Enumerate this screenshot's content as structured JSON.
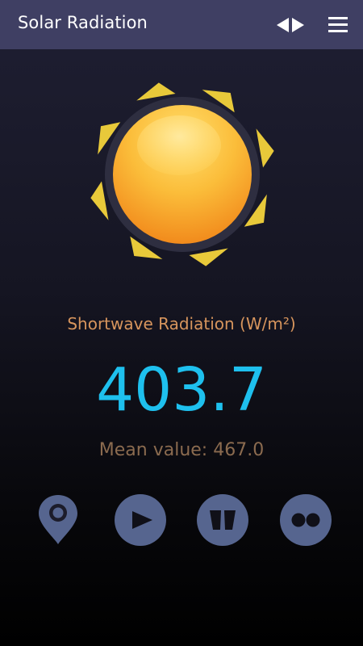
{
  "appbar": {
    "title": "Solar Radiation",
    "icons": [
      "swap-arrows-icon",
      "menu-icon"
    ]
  },
  "main": {
    "illustration": "sun-icon",
    "measurement_label": "Shortwave Radiation (W/m²)",
    "current_value": "403.7",
    "mean_text": "Mean value: 467.0"
  },
  "actions": {
    "icons": [
      "location-pin-icon",
      "play-icon",
      "book-icon",
      "dots-icon"
    ]
  },
  "colors": {
    "appbar": "#3f3f63",
    "label": "#d7955d",
    "value": "#1ec0ee",
    "mean": "#8b6b4f",
    "button": "#56658f",
    "sun_ray": "#e8c93a"
  }
}
